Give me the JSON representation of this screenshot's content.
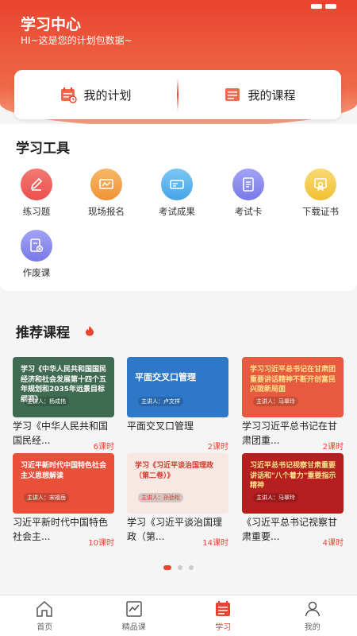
{
  "header": {
    "title": "学习中心",
    "subtitle": "HI~这是您的计划包数据~"
  },
  "plan": {
    "my_plan": "我的计划",
    "my_course": "我的课程"
  },
  "tools": {
    "title": "学习工具",
    "items": [
      {
        "label": "练习题",
        "icon": "edit-icon",
        "color": "#f0635f"
      },
      {
        "label": "现场报名",
        "icon": "chart-board-icon",
        "color": "#f5a04b"
      },
      {
        "label": "考试成果",
        "icon": "card-icon",
        "color": "#5bb4ec"
      },
      {
        "label": "考试卡",
        "icon": "document-icon",
        "color": "#8a8bef"
      },
      {
        "label": "下载证书",
        "icon": "certificate-icon",
        "color": "#f5cd4a"
      },
      {
        "label": "作废课",
        "icon": "doc-cancel-icon",
        "color": "#8a8bef"
      }
    ]
  },
  "recommend": {
    "title": "推荐课程",
    "courses": [
      {
        "thumb_text": "学习《中华人民共和国国民经济和社会发展第十四个五年规划和2035年远景目标纲要》",
        "speaker": "主讲人：杨成伟",
        "title": "学习《中华人民共和国国民经...",
        "lessons": "6课时",
        "bg": "#3f6b52",
        "fg": "#ffffff"
      },
      {
        "thumb_text": "平面交叉口管理",
        "speaker": "主讲人：卢文祥",
        "title": "平面交叉口管理",
        "lessons": "2课时",
        "bg": "#2f78c8",
        "fg": "#ffffff"
      },
      {
        "thumb_text": "学习习近平总书记在甘肃团重要讲话精神不断开创富民兴陇新局面",
        "speaker": "主讲人：马翠玲",
        "title": "学习习近平总书记在甘肃团重...",
        "lessons": "2课时",
        "bg": "#e85a3f",
        "fg": "#ffe28a"
      },
      {
        "thumb_text": "习近平新时代中国特色社会主义思想解读",
        "speaker": "主讲人：宋福岳",
        "title": "习近平新时代中国特色社会主...",
        "lessons": "10课时",
        "bg": "#e9503a",
        "fg": "#ffffff"
      },
      {
        "thumb_text": "学习《习近平谈治国理政（第二卷）》",
        "speaker": "主讲人：孙劲松",
        "title": "学习《习近平谈治国理政（第...",
        "lessons": "14课时",
        "bg": "#f7e8e4",
        "fg": "#d63a2c"
      },
      {
        "thumb_text": "习近平总书记视察甘肃重要讲话和\"八个着力\"重要指示精神",
        "speaker": "主讲人：马翠玲",
        "title": "《习近平总书记视察甘肃重要...",
        "lessons": "4课时",
        "bg": "#b51f1f",
        "fg": "#ffe28a"
      }
    ]
  },
  "tabbar": {
    "items": [
      {
        "label": "首页",
        "icon": "home-icon",
        "active": false
      },
      {
        "label": "精品课",
        "icon": "chart-icon",
        "active": false
      },
      {
        "label": "学习",
        "icon": "list-icon",
        "active": true
      },
      {
        "label": "我的",
        "icon": "user-icon",
        "active": false
      }
    ]
  }
}
